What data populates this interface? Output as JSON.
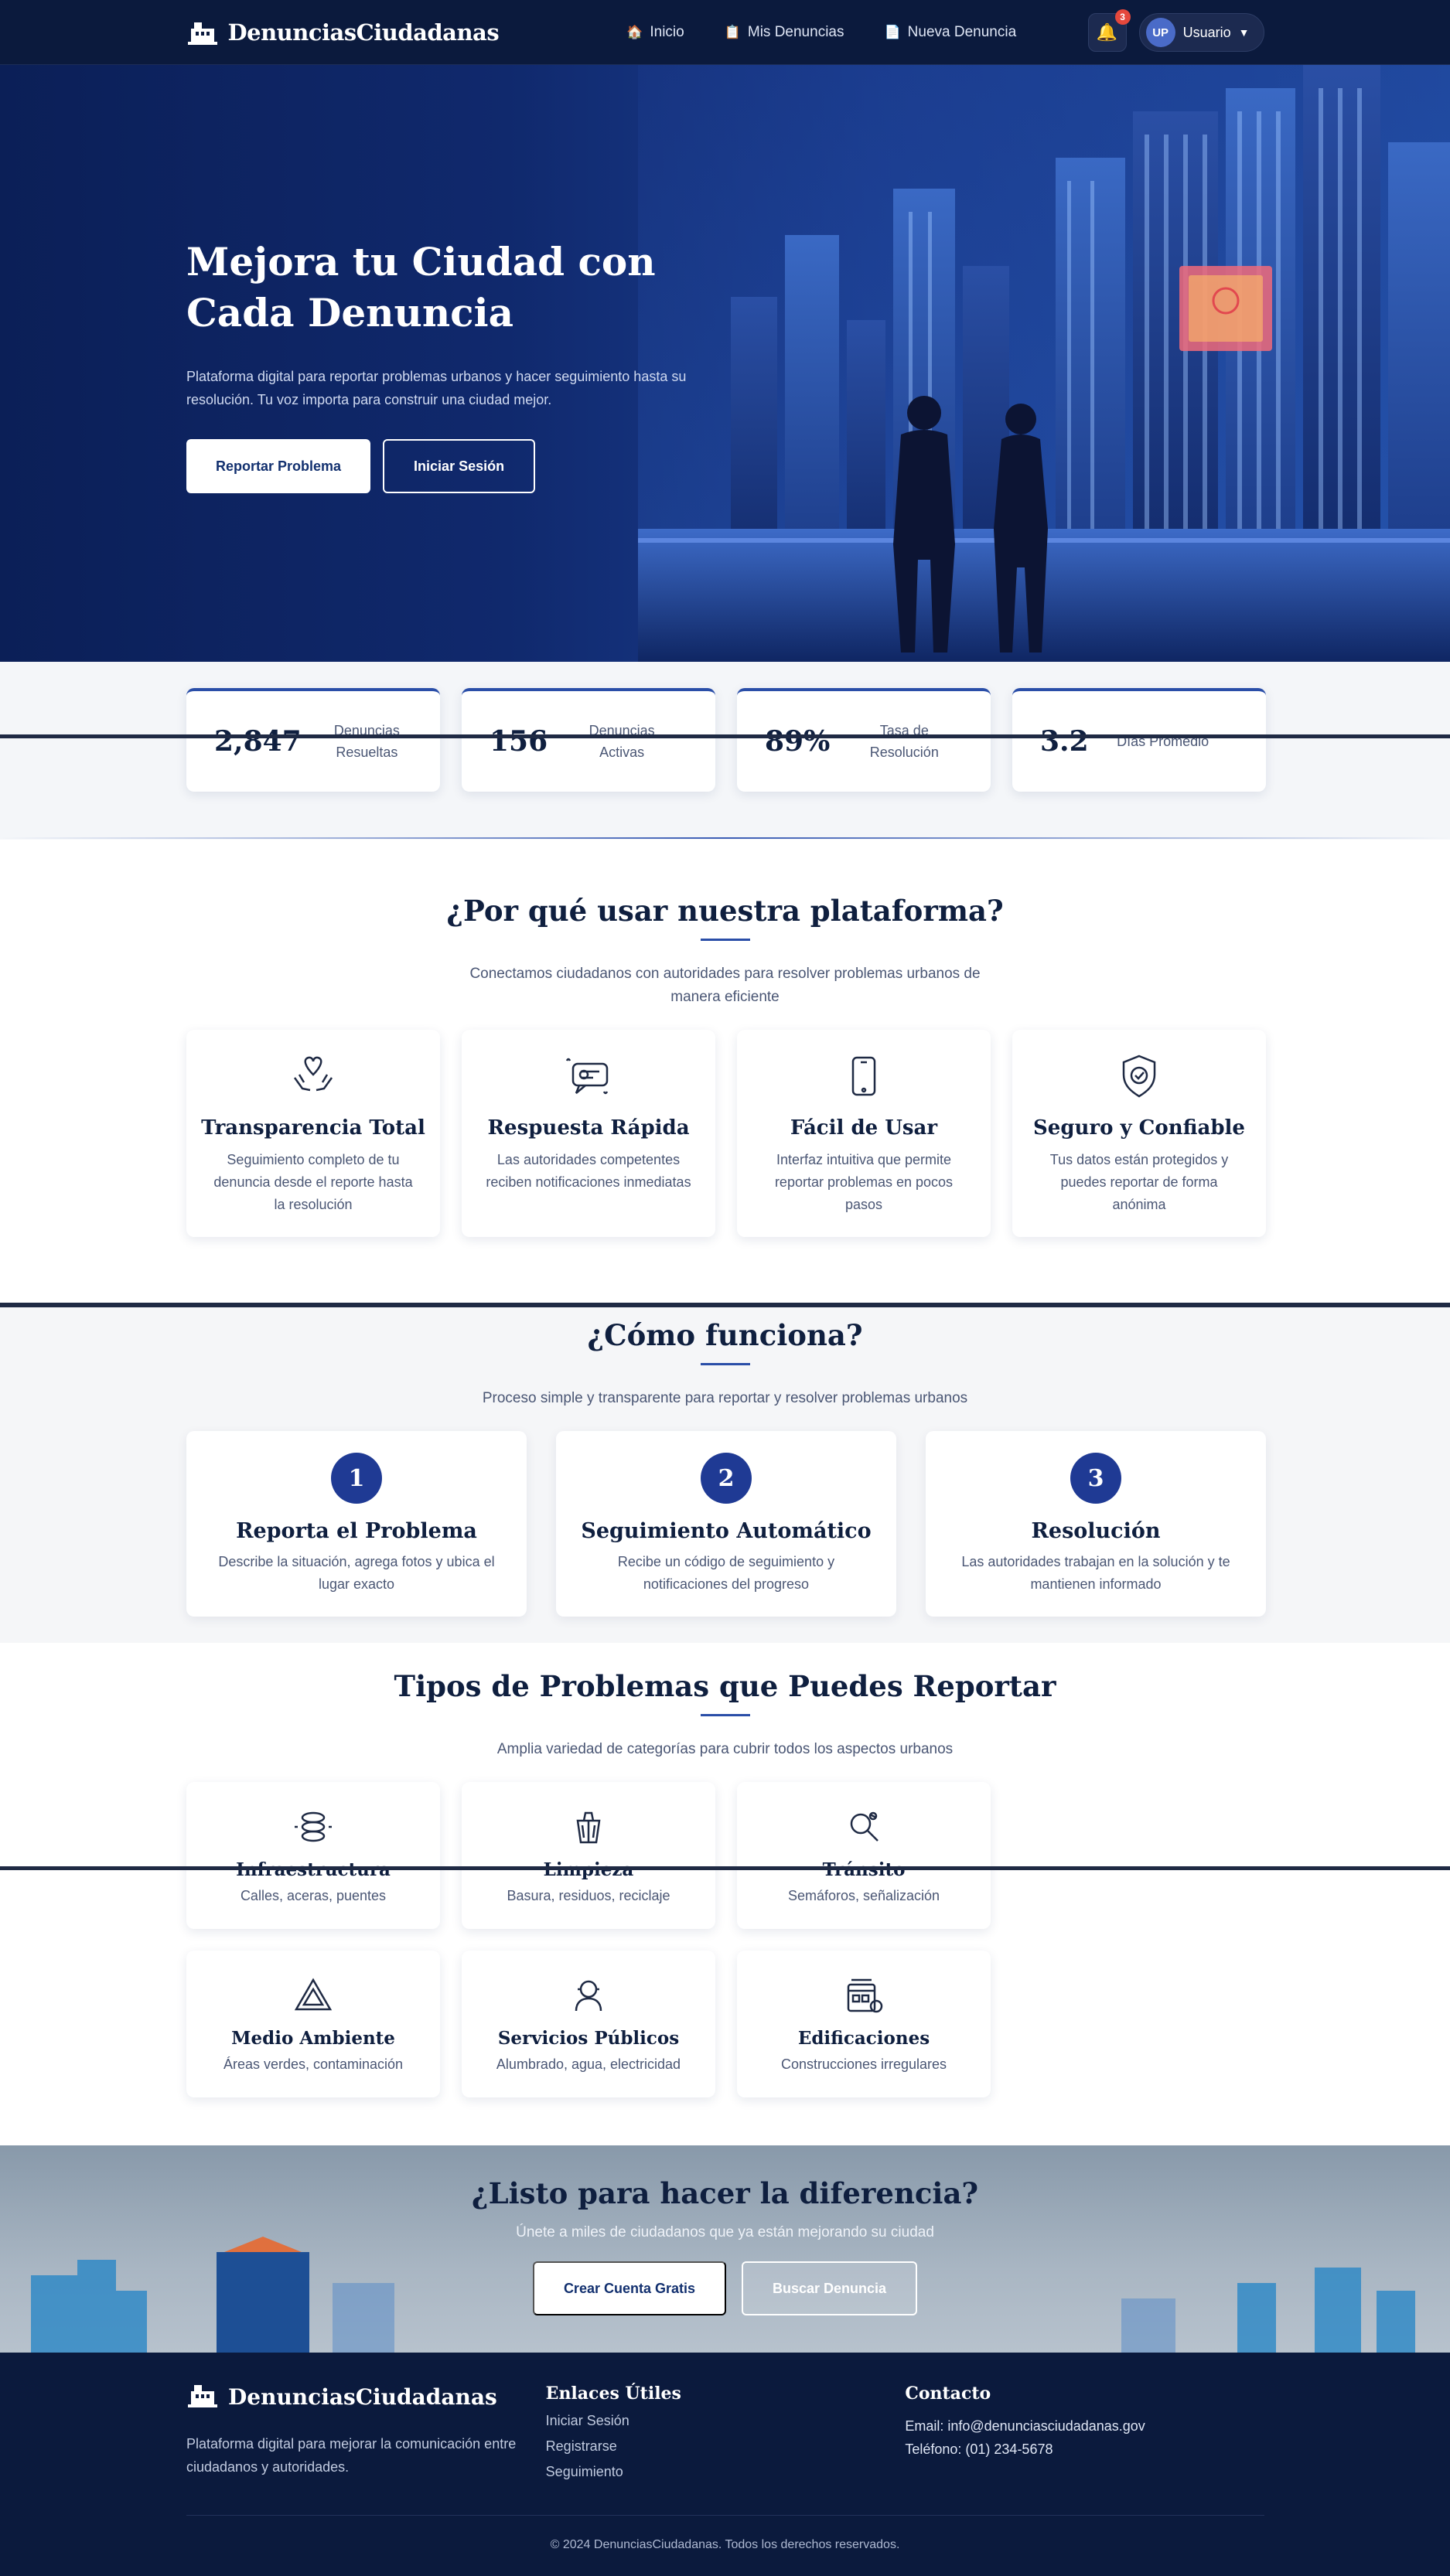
{
  "brand": {
    "name": "DenunciasCiudadanas",
    "logo_icon": "building-icon"
  },
  "nav": {
    "links": [
      {
        "label": "Inicio",
        "icon": "house-icon",
        "glyph": "🏠"
      },
      {
        "label": "Mis Denuncias",
        "icon": "clipboard-icon",
        "glyph": "📋"
      },
      {
        "label": "Nueva Denuncia",
        "icon": "document-icon",
        "glyph": "📄"
      }
    ],
    "notifications": {
      "count": "3",
      "icon": "bell-icon"
    },
    "user": {
      "initials": "UP",
      "label": "Usuario",
      "caret": "▼"
    }
  },
  "hero": {
    "title": "Mejora tu Ciudad con Cada Denuncia",
    "description": "Plataforma digital para reportar problemas urbanos y hacer seguimiento hasta su resolución. Tu voz importa para construir una ciudad mejor.",
    "primary_button": "Reportar Problema",
    "secondary_button": "Iniciar Sesión"
  },
  "stats": [
    {
      "value": "2,847",
      "label": "Denuncias Resueltas"
    },
    {
      "value": "156",
      "label": "Denuncias Activas"
    },
    {
      "value": "89%",
      "label": "Tasa de Resolución"
    },
    {
      "value": "3.2",
      "label": "Días Promedio"
    }
  ],
  "why": {
    "title": "¿Por qué usar nuestra plataforma?",
    "subtitle": "Conectamos ciudadanos con autoridades para resolver problemas urbanos de manera eficiente",
    "features": [
      {
        "title": "Transparencia Total",
        "description": "Seguimiento completo de tu denuncia desde el reporte hasta la resolución",
        "icon": "heart-hands-icon"
      },
      {
        "title": "Respuesta Rápida",
        "description": "Las autoridades competentes reciben notificaciones inmediatas",
        "icon": "fast-message-icon"
      },
      {
        "title": "Fácil de Usar",
        "description": "Interfaz intuitiva que permite reportar problemas en pocos pasos",
        "icon": "tablet-icon"
      },
      {
        "title": "Seguro y Confiable",
        "description": "Tus datos están protegidos y puedes reportar de forma anónima",
        "icon": "shield-check-icon"
      }
    ]
  },
  "how": {
    "title": "¿Cómo funciona?",
    "subtitle": "Proceso simple y transparente para reportar y resolver problemas urbanos",
    "steps": [
      {
        "number": "1",
        "title": "Reporta el Problema",
        "description": "Describe la situación, agrega fotos y ubica el lugar exacto"
      },
      {
        "number": "2",
        "title": "Seguimiento Automático",
        "description": "Recibe un código de seguimiento y notificaciones del progreso"
      },
      {
        "number": "3",
        "title": "Resolución",
        "description": "Las autoridades trabajan en la solución y te mantienen informado"
      }
    ]
  },
  "types": {
    "title": "Tipos de Problemas que Puedes Reportar",
    "subtitle": "Amplia variedad de categorías para cubrir todos los aspectos urbanos",
    "items": [
      {
        "title": "Infraestructura",
        "description": "Calles, aceras, puentes",
        "icon": "infrastructure-icon"
      },
      {
        "title": "Limpieza",
        "description": "Basura, residuos, reciclaje",
        "icon": "cleaning-icon"
      },
      {
        "title": "Tránsito",
        "description": "Semáforos, señalización",
        "icon": "traffic-icon"
      },
      {
        "title": "Medio Ambiente",
        "description": "Áreas verdes, contaminación",
        "icon": "environment-icon"
      },
      {
        "title": "Servicios Públicos",
        "description": "Alumbrado, agua, electricidad",
        "icon": "public-services-icon"
      },
      {
        "title": "Edificaciones",
        "description": "Construcciones irregulares",
        "icon": "buildings-icon"
      }
    ]
  },
  "cta": {
    "title": "¿Listo para hacer la diferencia?",
    "subtitle": "Únete a miles de ciudadanos que ya están mejorando su ciudad",
    "primary_button": "Crear Cuenta Gratis",
    "secondary_button": "Buscar Denuncia"
  },
  "footer": {
    "description": "Plataforma digital para mejorar la comunicación entre ciudadanos y autoridades.",
    "links_title": "Enlaces Útiles",
    "links": [
      "Iniciar Sesión",
      "Registrarse",
      "Seguimiento"
    ],
    "contact_title": "Contacto",
    "email": "Email: info@denunciasciudadanas.gov",
    "phone": "Teléfono: (01) 234-5678",
    "copyright": "© 2024 DenunciasCiudadanas. Todos los derechos reservados."
  },
  "colors": {
    "navy": "#0b1a3d",
    "accent": "#2a4ea8",
    "step_circle": "#1f3a94",
    "badge": "#e5483c"
  }
}
